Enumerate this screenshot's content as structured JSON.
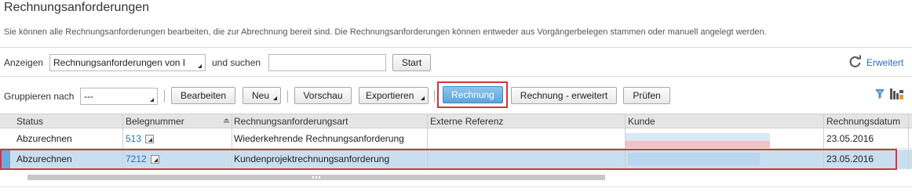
{
  "page": {
    "title": "Rechnungsanforderungen",
    "description": "Sie können alle Rechnungsanforderungen bearbeiten, die zur Abrechnung bereit sind. Die Rechnungsanforderungen können entweder aus Vorgängerbelegen stammen oder manuell angelegt werden."
  },
  "search": {
    "show_label": "Anzeigen",
    "show_value": "Rechnungsanforderungen von I",
    "and_search_label": "und suchen",
    "search_value": "",
    "start_label": "Start",
    "advanced_label": "Erweitert"
  },
  "toolbar": {
    "group_label": "Gruppieren nach",
    "group_value": "---",
    "edit_label": "Bearbeiten",
    "new_label": "Neu",
    "preview_label": "Vorschau",
    "export_label": "Exportieren",
    "invoice_label": "Rechnung",
    "invoice_advanced_label": "Rechnung - erweitert",
    "check_label": "Prüfen"
  },
  "table": {
    "columns": [
      "Status",
      "Belegnummer",
      "Rechnungsanforderungsart",
      "Externe Referenz",
      "Kunde",
      "Rechnungsdatum"
    ],
    "rows": [
      {
        "status": "Abzurechnen",
        "number": "513",
        "type": "Wiederkehrende Rechnungsanforderung",
        "external_ref": "",
        "customer": "",
        "date": "23.05.2016"
      },
      {
        "status": "Abzurechnen",
        "number": "7212",
        "type": "Kundenprojektrechnungsanforderung",
        "external_ref": "",
        "customer": "",
        "date": "23.05.2016"
      }
    ],
    "selected_row": 1
  },
  "colors": {
    "accent": "#2a6ebb",
    "highlight": "#d6333f",
    "selected_row": "#c9dff0",
    "primary_button": "#5aa5dc"
  },
  "icons": [
    "refresh-icon",
    "filter-icon",
    "table-settings-icon",
    "open-details-icon",
    "sort-asc-icon",
    "dropdown-arrow-icon"
  ]
}
